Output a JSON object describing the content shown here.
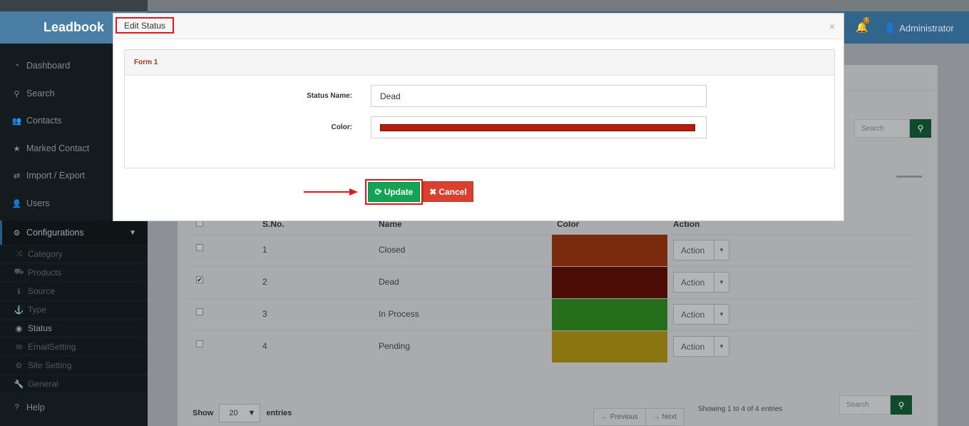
{
  "app": {
    "brand": "Leadbook"
  },
  "header": {
    "notification_count": "1",
    "user": "Administrator"
  },
  "sidebar": {
    "items": [
      {
        "label": "Dashboard",
        "icon": "dashboard-icon"
      },
      {
        "label": "Search",
        "icon": "search-icon"
      },
      {
        "label": "Contacts",
        "icon": "users-icon"
      },
      {
        "label": "Marked Contact",
        "icon": "star-icon"
      },
      {
        "label": "Import / Export",
        "icon": "exchange-icon"
      },
      {
        "label": "Users",
        "icon": "user-icon"
      },
      {
        "label": "Configurations",
        "icon": "cogs-icon"
      }
    ],
    "sub_items": [
      {
        "label": "Category",
        "icon": "random-icon"
      },
      {
        "label": "Products",
        "icon": "cart-icon"
      },
      {
        "label": "Source",
        "icon": "info-icon"
      },
      {
        "label": "Type",
        "icon": "anchor-icon"
      },
      {
        "label": "Status",
        "icon": "eye-icon"
      },
      {
        "label": "EmailSetting",
        "icon": "envelope-icon"
      },
      {
        "label": "Site Setting",
        "icon": "gear-icon"
      },
      {
        "label": "General",
        "icon": "wrench-icon"
      }
    ],
    "help": "Help"
  },
  "content": {
    "search_placeholder": "Search",
    "table": {
      "headers": [
        "S.No.",
        "Name",
        "Color",
        "Action"
      ],
      "rows": [
        {
          "sno": "1",
          "name": "Closed",
          "color": "#7a2a0d",
          "checked": false
        },
        {
          "sno": "2",
          "name": "Dead",
          "color": "#4a0c05",
          "checked": true
        },
        {
          "sno": "3",
          "name": "In Process",
          "color": "#256e1c",
          "checked": false
        },
        {
          "sno": "4",
          "name": "Pending",
          "color": "#8a7510",
          "checked": false
        }
      ],
      "action_label": "Action"
    },
    "footer": {
      "show_label": "Show",
      "entries_value": "20",
      "entries_label": "entries",
      "showing": "Showing 1 to 4 of 4 entries",
      "prev": "← Previous",
      "next": "→ Next",
      "search_placeholder": "Search"
    }
  },
  "modal": {
    "title": "Edit Status",
    "close": "×",
    "form_title": "Form 1",
    "status_label": "Status Name:",
    "status_value": "Dead",
    "color_label": "Color:",
    "color_value": "#b91c0a",
    "update_label": "Update",
    "cancel_label": "Cancel"
  }
}
